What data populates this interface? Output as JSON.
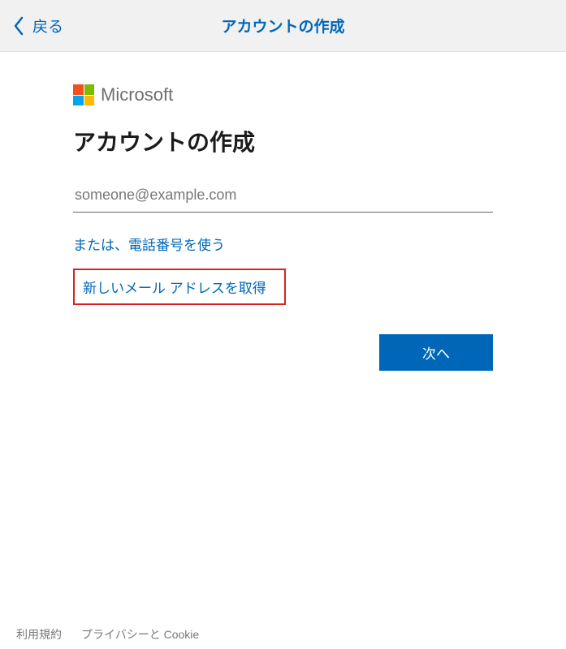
{
  "header": {
    "back_label": "戻る",
    "title": "アカウントの作成"
  },
  "logo": {
    "text": "Microsoft"
  },
  "main": {
    "heading": "アカウントの作成",
    "email_placeholder": "someone@example.com",
    "use_phone_link": "または、電話番号を使う",
    "get_new_email_link": "新しいメール アドレスを取得",
    "next_button": "次へ"
  },
  "footer": {
    "terms": "利用規約",
    "privacy": "プライバシーと Cookie"
  },
  "colors": {
    "brand_blue": "#0067b8",
    "highlight_red": "#d82323"
  }
}
